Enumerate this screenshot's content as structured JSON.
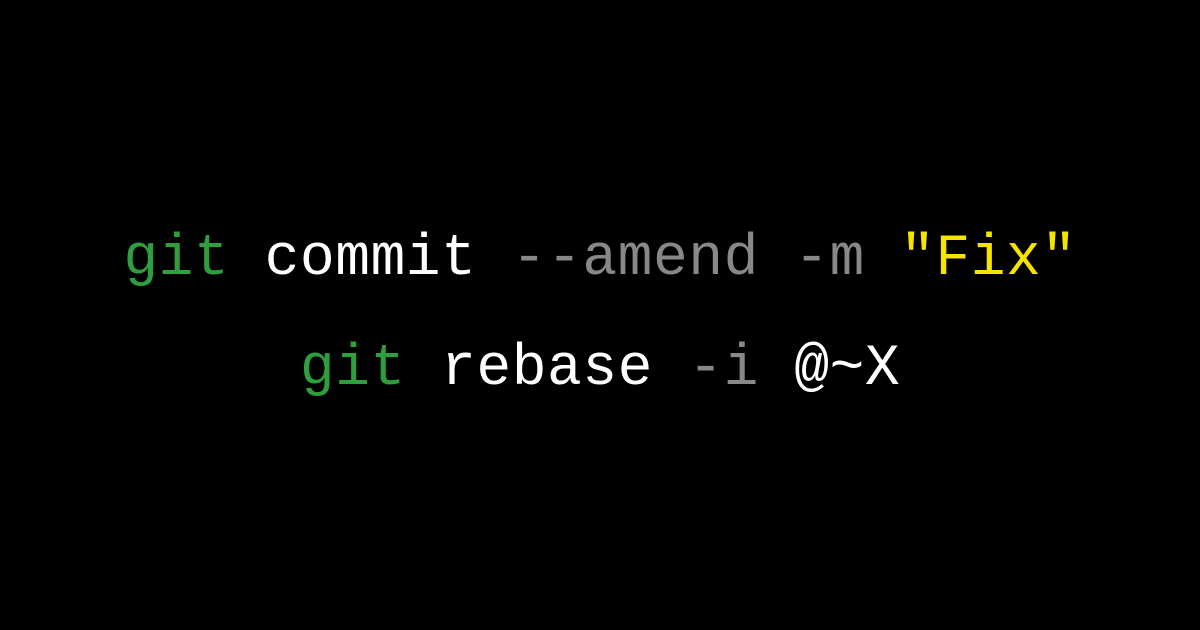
{
  "colors": {
    "background": "#000000",
    "command": "#2e9e3f",
    "subcommand": "#ffffff",
    "flag": "#888888",
    "string": "#f5e400",
    "reference": "#ffffff"
  },
  "line1": {
    "cmd": "git",
    "sub": "commit",
    "flag1": "--amend",
    "flag2": "-m",
    "str": "\"Fix\""
  },
  "line2": {
    "cmd": "git",
    "sub": "rebase",
    "flag": "-i",
    "ref": "@~X"
  }
}
